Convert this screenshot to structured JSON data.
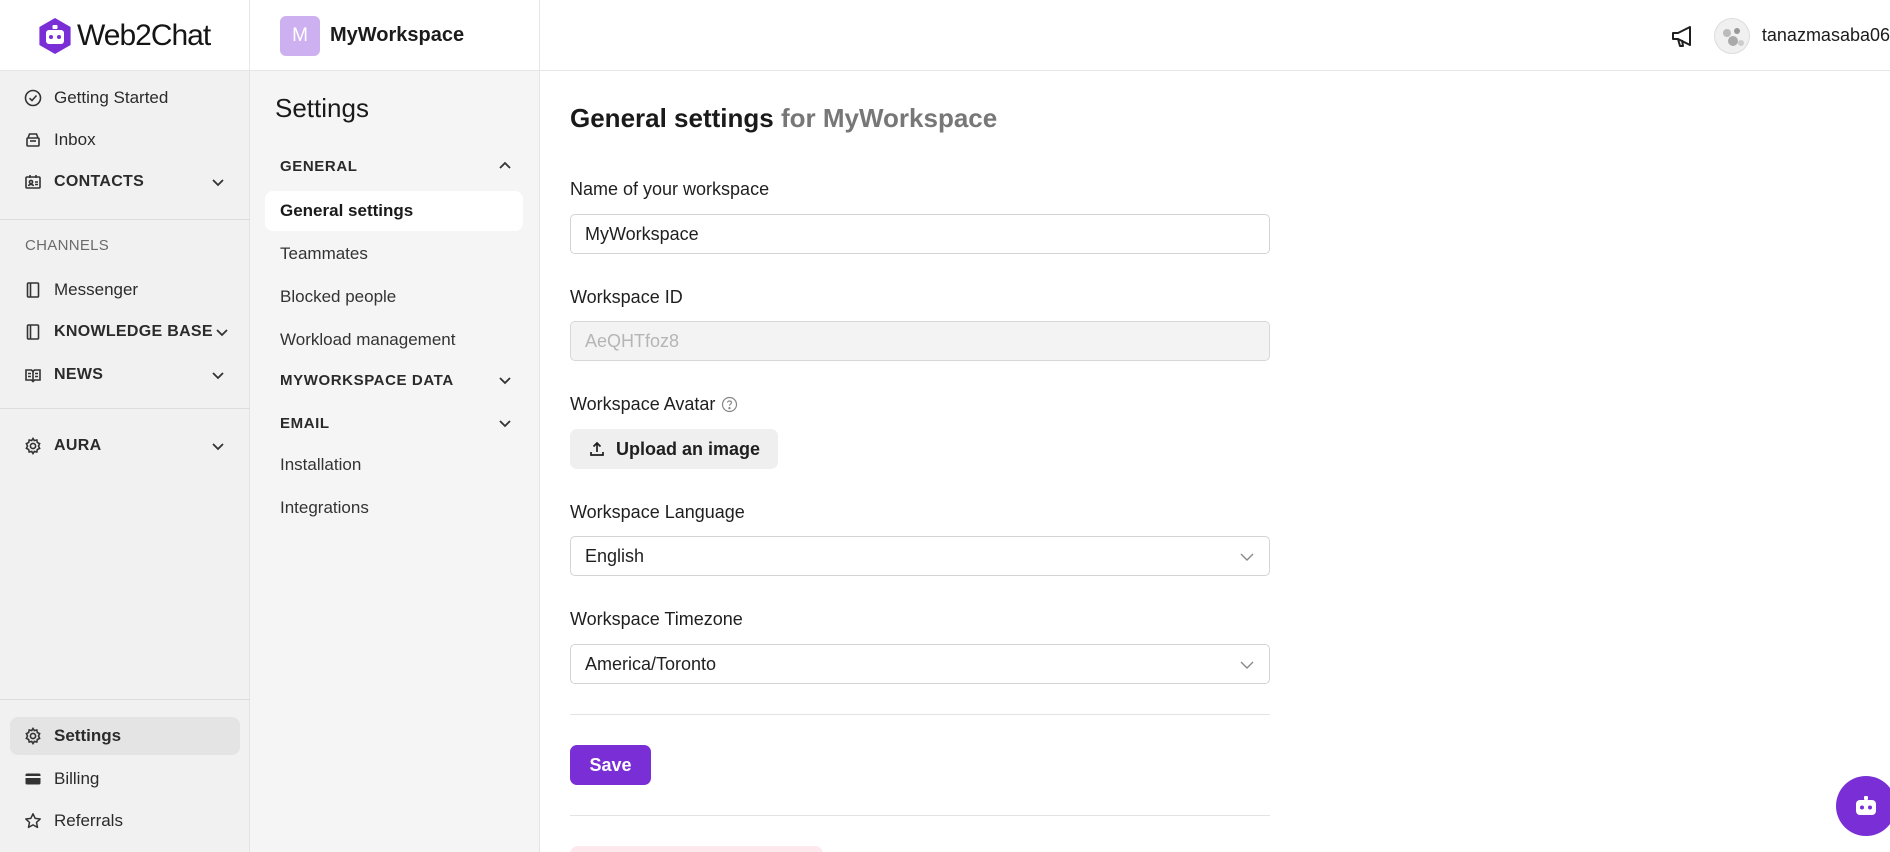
{
  "brand": {
    "name": "Web2Chat"
  },
  "workspace": {
    "initial": "M",
    "name": "MyWorkspace"
  },
  "user": {
    "name": "tanazmasaba06"
  },
  "sidebar": {
    "items": [
      {
        "label": "Getting Started",
        "icon": "check-circle-icon"
      },
      {
        "label": "Inbox",
        "icon": "inbox-icon"
      },
      {
        "label": "CONTACTS",
        "icon": "contacts-icon"
      }
    ],
    "channels_label": "CHANNELS",
    "channels": [
      {
        "label": "Messenger",
        "icon": "book-icon"
      },
      {
        "label": "KNOWLEDGE BASE",
        "icon": "book-icon"
      },
      {
        "label": "NEWS",
        "icon": "news-icon"
      }
    ],
    "aura": {
      "label": "AURA",
      "icon": "gear-icon"
    },
    "bottom": [
      {
        "label": "Settings",
        "icon": "gear-icon"
      },
      {
        "label": "Billing",
        "icon": "card-icon"
      },
      {
        "label": "Referrals",
        "icon": "star-icon"
      }
    ]
  },
  "subnav": {
    "title": "Settings",
    "general_label": "GENERAL",
    "general_items": [
      "General settings",
      "Teammates",
      "Blocked people",
      "Workload management"
    ],
    "data_label": "MYWORKSPACE DATA",
    "email_label": "EMAIL",
    "other_items": [
      "Installation",
      "Integrations"
    ]
  },
  "main": {
    "title": "General settings",
    "title_suffix": "for MyWorkspace",
    "name_label": "Name of your workspace",
    "name_value": "MyWorkspace",
    "id_label": "Workspace ID",
    "id_value": "AeQHTfoz8",
    "avatar_label": "Workspace Avatar",
    "upload_label": "Upload an image",
    "language_label": "Workspace Language",
    "language_value": "English",
    "timezone_label": "Workspace Timezone",
    "timezone_value": "America/Toronto",
    "save_label": "Save"
  },
  "colors": {
    "accent": "#7a2fd6",
    "workspace_avatar": "#cdb0ef"
  }
}
